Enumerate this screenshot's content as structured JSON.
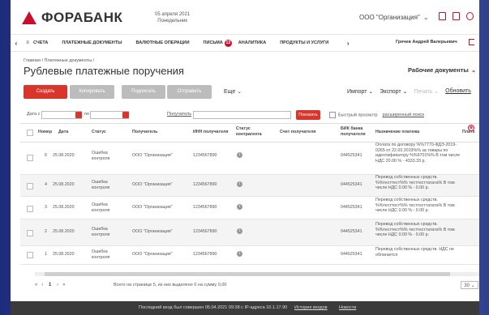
{
  "header": {
    "bank_name": "ФОРАБАНК",
    "date": "05 апреля 2021",
    "weekday": "Понедельник",
    "organization": "ООО \"Организация\"",
    "icons": [
      "document-icon",
      "camera-icon",
      "settings-icon"
    ],
    "accent": "#c8102e"
  },
  "nav": {
    "items": [
      {
        "label": "СЧЕТА"
      },
      {
        "label": "ПЛАТЕЖНЫЕ ДОКУМЕНТЫ"
      },
      {
        "label": "ВАЛЮТНЫЕ ОПЕРАЦИИ"
      },
      {
        "label": "ПИСЬМА",
        "badge": "13"
      },
      {
        "label": "АНАЛИТИКА"
      },
      {
        "label": "ПРОДУКТЫ И УСЛУГИ"
      }
    ],
    "user": "Гречев Андрей Валерьевич"
  },
  "breadcrumb": "Главная / Платежные документы /",
  "page": {
    "title": "Рублевые платежные поручения",
    "work_docs": "Рабочие документы"
  },
  "toolbar": {
    "create": "Создать",
    "copy": "Копировать",
    "sign": "Подписать",
    "send": "Отправить",
    "more": "Еще",
    "import": "Импорт",
    "export": "Экспорт",
    "print": "Печать",
    "refresh": "Обновить"
  },
  "filter": {
    "date_from_label": "Дата с",
    "date_to_label": "по",
    "payee_label": "Получатель",
    "show": "Показать",
    "quick_view": "Быстрый просмотр",
    "advanced": "расширенный поиск"
  },
  "table": {
    "columns": [
      "Номер",
      "Дата",
      "Статус",
      "Получатель",
      "ИНН получателя",
      "Статус контрагента",
      "Счет получателя",
      "БИК банка получателя",
      "Назначение платежа",
      "Плате"
    ],
    "rows": [
      {
        "num": "6",
        "date": "25.08.2020",
        "status": "Ошибка контроля",
        "payee": "ООО \"Организация\"",
        "inn": "1234567890",
        "bik": "044525341",
        "purpose": "Оплата по договору %%7770-ФДЭ-2019-0265 от 22.03.2019%% за товары по идентификатору %%9701%% В том числе НДС 20.00 % - 4333.33 р."
      },
      {
        "num": "4",
        "date": "25.08.2020",
        "status": "Ошибка контроля",
        "payee": "ООО \"Организация\"",
        "inn": "1234567890",
        "bik": "044525341",
        "purpose": "Перевод собственных средств. %%тесттест%% тесттесттатата% В том числе НДС 0.00 % - 0.00 р."
      },
      {
        "num": "3",
        "date": "25.08.2020",
        "status": "Ошибка контроля",
        "payee": "ООО \"Организация\"",
        "inn": "1234567890",
        "bik": "044525341",
        "purpose": "Перевод собственных средств. %%тесттест%% тесттесттатата% В том числе НДС 0.00 % - 0.00 р."
      },
      {
        "num": "2",
        "date": "25.08.2020",
        "status": "Ошибка контроля",
        "payee": "ООО \"Организация\"",
        "inn": "1234567890",
        "bik": "044525341",
        "purpose": "Перевод собственных средств. %%тесттест%% тесттесттатата% В том числе НДС 0.00 % - 0.00 р."
      },
      {
        "num": "1",
        "date": "25.08.2020",
        "status": "Ошибка контроля",
        "payee": "ООО \"Организация\"",
        "inn": "1234567890",
        "bik": "044525341",
        "purpose": "Перевод собственных средств. НДС не облагается"
      }
    ]
  },
  "pager": {
    "page": "1",
    "total": "Всего на странице 5, из них выделено 0 на сумму 0,00",
    "page_size": "30"
  },
  "footer": {
    "last_login": "Последний вход был совершен 05.04.2021 09:38 с IP-адреса 10.1.17.90",
    "history": "История входов",
    "news": "Новости"
  }
}
